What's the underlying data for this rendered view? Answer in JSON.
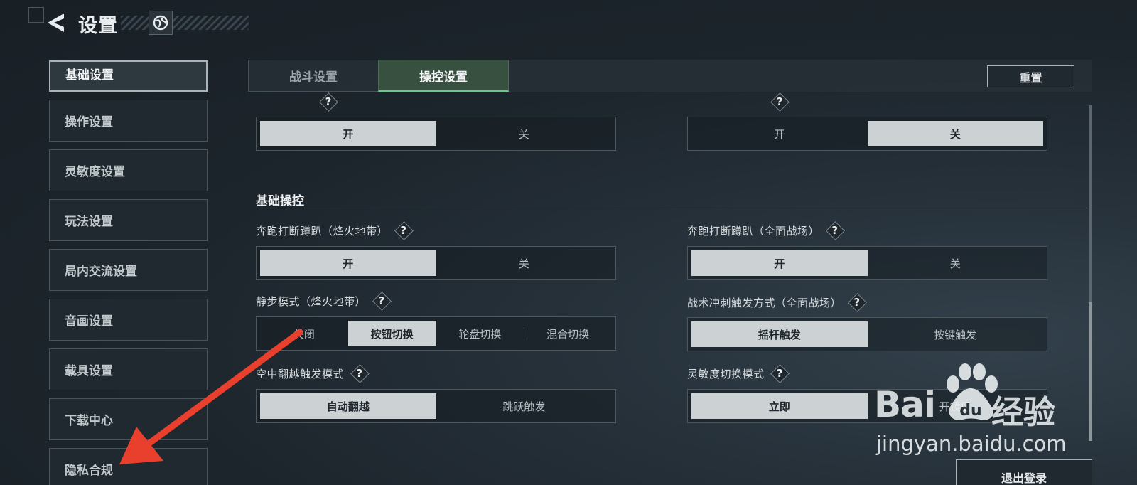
{
  "header": {
    "title": "设置"
  },
  "sidebar": {
    "items": [
      {
        "label": "基础设置",
        "active": true
      },
      {
        "label": "操作设置"
      },
      {
        "label": "灵敏度设置"
      },
      {
        "label": "玩法设置"
      },
      {
        "label": "局内交流设置"
      },
      {
        "label": "音画设置"
      },
      {
        "label": "载具设置"
      },
      {
        "label": "下载中心"
      },
      {
        "label": "隐私合规"
      }
    ]
  },
  "tabs": [
    {
      "label": "战斗设置"
    },
    {
      "label": "操控设置",
      "active": true
    }
  ],
  "reset_label": "重置",
  "help_glyph": "?",
  "top_row": {
    "left": {
      "options": [
        "开",
        "关"
      ],
      "selected": "开"
    },
    "right": {
      "options": [
        "开",
        "关"
      ],
      "selected": "关"
    }
  },
  "section": {
    "title": "基础操控"
  },
  "settings": [
    {
      "label": "奔跑打断蹲趴（烽火地带）",
      "options": [
        "开",
        "关"
      ],
      "selected": "开"
    },
    {
      "label": "奔跑打断蹲趴（全面战场）",
      "options": [
        "开",
        "关"
      ],
      "selected": "开"
    },
    {
      "label": "静步模式（烽火地带）",
      "options": [
        "关闭",
        "按钮切换",
        "轮盘切换",
        "混合切换"
      ],
      "selected": "按钮切换"
    },
    {
      "label": "战术冲刺触发方式（全面战场）",
      "options": [
        "摇杆触发",
        "按键触发"
      ],
      "selected": "摇杆触发"
    },
    {
      "label": "空中翻越触发模式",
      "options": [
        "自动翻越",
        "跳跃触发"
      ],
      "selected": "自动翻越"
    },
    {
      "label": "灵敏度切换模式",
      "options": [
        "立即",
        "开镜后"
      ],
      "selected": "立即"
    }
  ],
  "logout_label": "退出登录",
  "watermark": {
    "brand": "Bai",
    "cn": "经验",
    "url": "jingyan.baidu.com"
  },
  "colors": {
    "accent": "#68c98d",
    "selected_option": "#ccd1d3",
    "annotation_arrow": "#e8402c"
  }
}
